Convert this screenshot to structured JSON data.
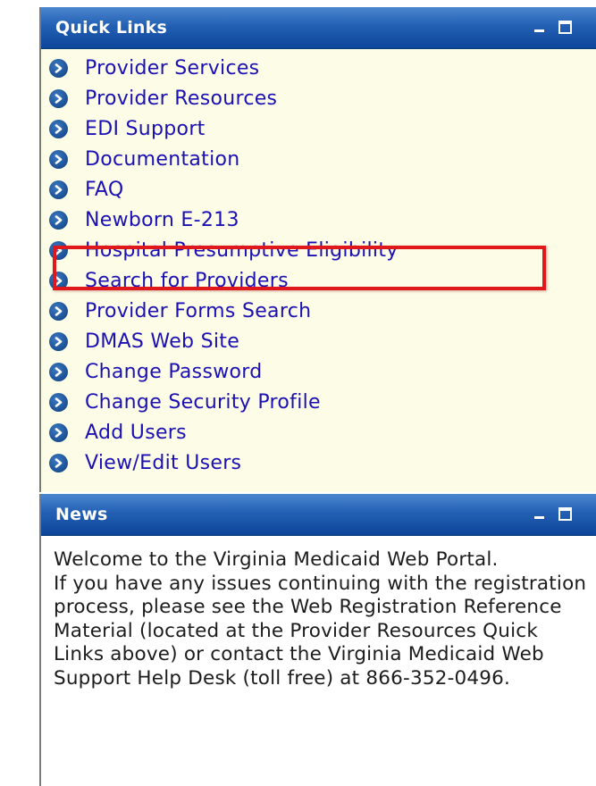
{
  "quick_links": {
    "title": "Quick Links",
    "items": [
      {
        "label": "Provider Services",
        "name": "quick-link-provider-services"
      },
      {
        "label": "Provider Resources",
        "name": "quick-link-provider-resources"
      },
      {
        "label": "EDI Support",
        "name": "quick-link-edi-support"
      },
      {
        "label": "Documentation",
        "name": "quick-link-documentation"
      },
      {
        "label": "FAQ",
        "name": "quick-link-faq"
      },
      {
        "label": "Newborn E-213",
        "name": "quick-link-newborn-e213"
      },
      {
        "label": "Hospital Presumptive Eligibility",
        "name": "quick-link-hospital-presumptive-eligibility"
      },
      {
        "label": "Search for Providers",
        "name": "quick-link-search-for-providers"
      },
      {
        "label": "Provider Forms Search",
        "name": "quick-link-provider-forms-search"
      },
      {
        "label": "DMAS Web Site",
        "name": "quick-link-dmas-web-site"
      },
      {
        "label": "Change Password",
        "name": "quick-link-change-password"
      },
      {
        "label": "Change Security Profile",
        "name": "quick-link-change-security-profile"
      },
      {
        "label": "Add Users",
        "name": "quick-link-add-users"
      },
      {
        "label": "View/Edit Users",
        "name": "quick-link-view-edit-users"
      }
    ],
    "icon": "arrow-circle-icon",
    "highlighted_item": "Hospital Presumptive Eligibility"
  },
  "news": {
    "title": "News",
    "paragraphs": [
      "Welcome to the Virginia Medicaid Web Portal.",
      "If you have any issues continuing with the registration process, please see the Web Registration Reference Material (located at the Provider Resources Quick Links above) or contact the Virginia Medicaid Web Support Help Desk (toll free) at 866-352-0496."
    ]
  },
  "colors": {
    "header_gradient_top": "#4c86cf",
    "header_gradient_bottom": "#0d4599",
    "links_background": "#fdfde7",
    "link_text": "#1a10b4",
    "highlight_border": "#e0181c"
  }
}
